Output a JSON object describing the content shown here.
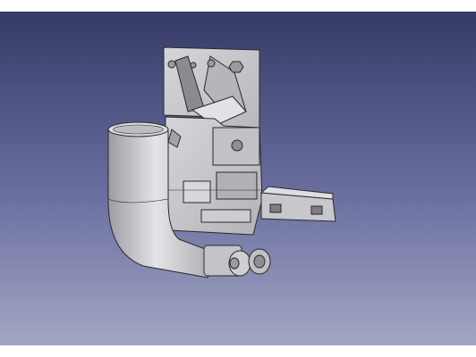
{
  "viewport": {
    "background_top": "#363a66",
    "background_bottom": "#a3a6c3"
  },
  "model": {
    "render_style": "shaded with edges",
    "body_color": "#c9c9cd",
    "edge_color": "#2a2a2a",
    "parts": [
      {
        "name": "mount-bracket-top"
      },
      {
        "name": "central-block"
      },
      {
        "name": "elbow-duct"
      },
      {
        "name": "side-arm"
      },
      {
        "name": "hinge-knuckle"
      }
    ]
  }
}
